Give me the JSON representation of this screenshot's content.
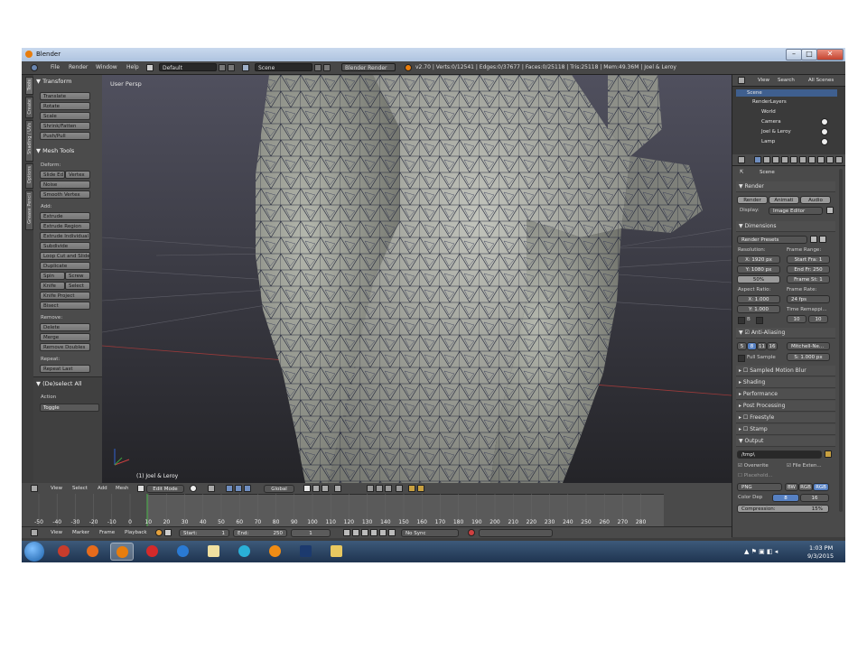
{
  "window": {
    "title": "Blender"
  },
  "infobar": {
    "menus": [
      "File",
      "Render",
      "Window",
      "Help"
    ],
    "layout": "Default",
    "scene": "Scene",
    "engine": "Blender Render",
    "stats": "v2.70 | Verts:0/12541 | Edges:0/37677 | Faces:0/25118 | Tris:25118 | Mem:49.36M | Joel & Leroy"
  },
  "toolshelf": {
    "tabs": [
      "Tools",
      "Create",
      "Shading / UVs",
      "Options",
      "Grease Pencil"
    ],
    "transform": {
      "header": "Transform",
      "buttons": [
        "Translate",
        "Rotate",
        "Scale",
        "Shrink/Fatten",
        "Push/Pull"
      ]
    },
    "mesh_tools": {
      "header": "Mesh Tools",
      "deform_label": "Deform:",
      "slide_edge": "Slide Ed",
      "vertex": "Vertex",
      "noise": "Noise",
      "smooth_vertex": "Smooth Vertex",
      "add_label": "Add:",
      "extrude": "Extrude",
      "extrude_region": "Extrude Region",
      "extrude_individual": "Extrude Individual",
      "subdivide": "Subdivide",
      "loop_cut": "Loop Cut and Slide",
      "duplicate": "Duplicate",
      "spin": "Spin",
      "screw": "Screw",
      "knife": "Knife",
      "select": "Select",
      "knife_project": "Knife Project",
      "bisect": "Bisect",
      "remove_label": "Remove:",
      "delete": "Delete",
      "merge": "Merge",
      "remove_doubles": "Remove Doubles",
      "repeat_label": "Repeat:",
      "repeat_last": "Repeat Last"
    },
    "operator": {
      "header": "(De)select All",
      "action_label": "Action",
      "action_value": "Toggle"
    }
  },
  "viewport": {
    "view_name": "User Persp",
    "object_label": "(1) Joel & Leroy"
  },
  "view3d_header": {
    "menus": [
      "View",
      "Select",
      "Add",
      "Mesh"
    ],
    "mode": "Edit Mode",
    "orientation": "Global"
  },
  "timeline": {
    "ticks": [
      "-50",
      "-40",
      "-30",
      "-20",
      "-10",
      "0",
      "10",
      "20",
      "30",
      "40",
      "50",
      "60",
      "70",
      "80",
      "90",
      "100",
      "110",
      "120",
      "130",
      "140",
      "150",
      "160",
      "170",
      "180",
      "190",
      "200",
      "210",
      "220",
      "230",
      "240",
      "250",
      "260",
      "270",
      "280"
    ],
    "menus": [
      "View",
      "Marker",
      "Frame",
      "Playback"
    ],
    "start": "Start:",
    "start_val": "1",
    "end": "End:",
    "end_val": "250",
    "current": "1",
    "sync": "No Sync"
  },
  "outliner": {
    "tabs": [
      "View",
      "Search",
      "All Scenes"
    ],
    "items": [
      "Scene",
      "RenderLayers",
      "World",
      "Camera",
      "Joel & Leroy",
      "Lamp"
    ]
  },
  "properties": {
    "context": "Scene",
    "render_panel": {
      "header": "Render",
      "buttons": [
        "Render",
        "Animati",
        "Audio"
      ],
      "display_label": "Display:",
      "display_value": "Image Editor"
    },
    "dimensions": {
      "header": "Dimensions",
      "presets": "Render Presets",
      "resolution_label": "Resolution:",
      "res_x": "X: 1920 px",
      "res_y": "Y: 1080 px",
      "res_pct": "50%",
      "frame_range_label": "Frame Range:",
      "start_frame": "Start Fra: 1",
      "end_frame": "End Fr: 250",
      "frame_step": "Frame St: 1",
      "aspect_label": "Aspect Ratio:",
      "aspect_x": "X: 1.000",
      "aspect_y": "Y: 1.000",
      "frame_rate_label": "Frame Rate:",
      "fps": "24 fps",
      "remap_label": "Time Remappi...",
      "remap_old": "10",
      "remap_new": "10",
      "border_b": "B"
    },
    "antialias": {
      "header": "Anti-Aliasing",
      "samples": [
        "5",
        "8",
        "11",
        "16"
      ],
      "filter": "Mitchell-Ne...",
      "full_sample": "Full Sample",
      "size": "S: 1.000 px"
    },
    "collapsed": [
      "Sampled Motion Blur",
      "Shading",
      "Performance",
      "Post Processing",
      "Freestyle",
      "Stamp"
    ],
    "output": {
      "header": "Output",
      "path": "/tmp\\",
      "overwrite": "Overwrite",
      "file_ext": "File Exten...",
      "placeholders": "Placehold...",
      "format": "PNG",
      "bw": "BW",
      "rgb": "RGB",
      "rgba": "RGB",
      "color_depth_label": "Color Dep",
      "depth_8": "8",
      "depth_16": "16",
      "compression": "Compression:",
      "compression_val": "15%"
    }
  },
  "taskbar": {
    "time": "1:03 PM",
    "date": "9/3/2015"
  }
}
